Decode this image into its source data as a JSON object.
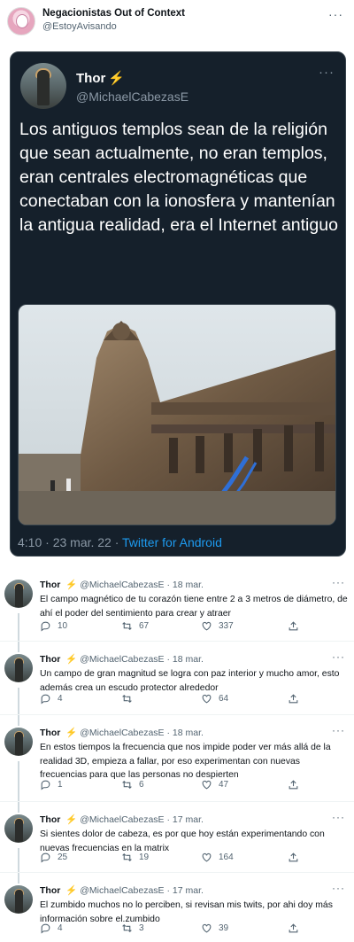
{
  "header": {
    "name": "Negacionistas Out of Context",
    "handle": "@EstoyAvisando",
    "more": "···"
  },
  "quoted": {
    "name": "Thor",
    "emoji": "⚡",
    "handle": "@MichaelCabezasE",
    "more": "···",
    "text": "Los antiguos templos sean de la religión que sean actualmente, no eran templos, eran centrales electromagnéticas que conectaban con la ionosfera y mantenían la antigua realidad, era el Internet antiguo",
    "time": "4:10 · 23 mar. 22 · ",
    "source": "Twitter for Android",
    "theme": {
      "background": "#15202b",
      "text": "#ffffff",
      "muted": "#8b98a5",
      "accent": "#1d9bf0"
    }
  },
  "replies": [
    {
      "name": "Thor",
      "emoji": "⚡",
      "handle": "@MichaelCabezasE",
      "date": "· 18 mar.",
      "text": "El campo magnético de tu corazón tiene entre 2 a 3 metros de diámetro, de ahí el poder del sentimiento para crear y atraer",
      "replies": "10",
      "retweets": "67",
      "likes": "337"
    },
    {
      "name": "Thor",
      "emoji": "⚡",
      "handle": "@MichaelCabezasE",
      "date": "· 18 mar.",
      "text": "Un campo de gran magnitud se logra con paz interior y mucho amor, esto además crea un escudo protector alrededor",
      "replies": "4",
      "retweets": "",
      "likes": "64"
    },
    {
      "name": "Thor",
      "emoji": "⚡",
      "handle": "@MichaelCabezasE",
      "date": "· 18 mar.",
      "text": "En estos tiempos la frecuencia que nos impide poder ver más allá de la realidad 3D, empieza a fallar, por eso experimentan con nuevas frecuencias para que las personas no despierten",
      "replies": "1",
      "retweets": "6",
      "likes": "47"
    },
    {
      "name": "Thor",
      "emoji": "⚡",
      "handle": "@MichaelCabezasE",
      "date": "· 17 mar.",
      "text": "Si sientes dolor de cabeza, es por que hoy están experimentando con nuevas frecuencias en la matrix",
      "replies": "25",
      "retweets": "19",
      "likes": "164"
    },
    {
      "name": "Thor",
      "emoji": "⚡",
      "handle": "@MichaelCabezasE",
      "date": "· 17 mar.",
      "text": "El zumbido muchos no lo perciben, si revisan mis twits, por ahi doy más información sobre el.zumbido",
      "replies": "4",
      "retweets": "3",
      "likes": "39"
    }
  ],
  "icons": {
    "reply": "reply-icon",
    "retweet": "retweet-icon",
    "like": "heart-icon",
    "share": "share-icon",
    "verified_emoji": "lightning-emoji"
  },
  "colors": {
    "muted": "#536471",
    "lightning": "#f7b928",
    "divider": "#eff3f4"
  }
}
